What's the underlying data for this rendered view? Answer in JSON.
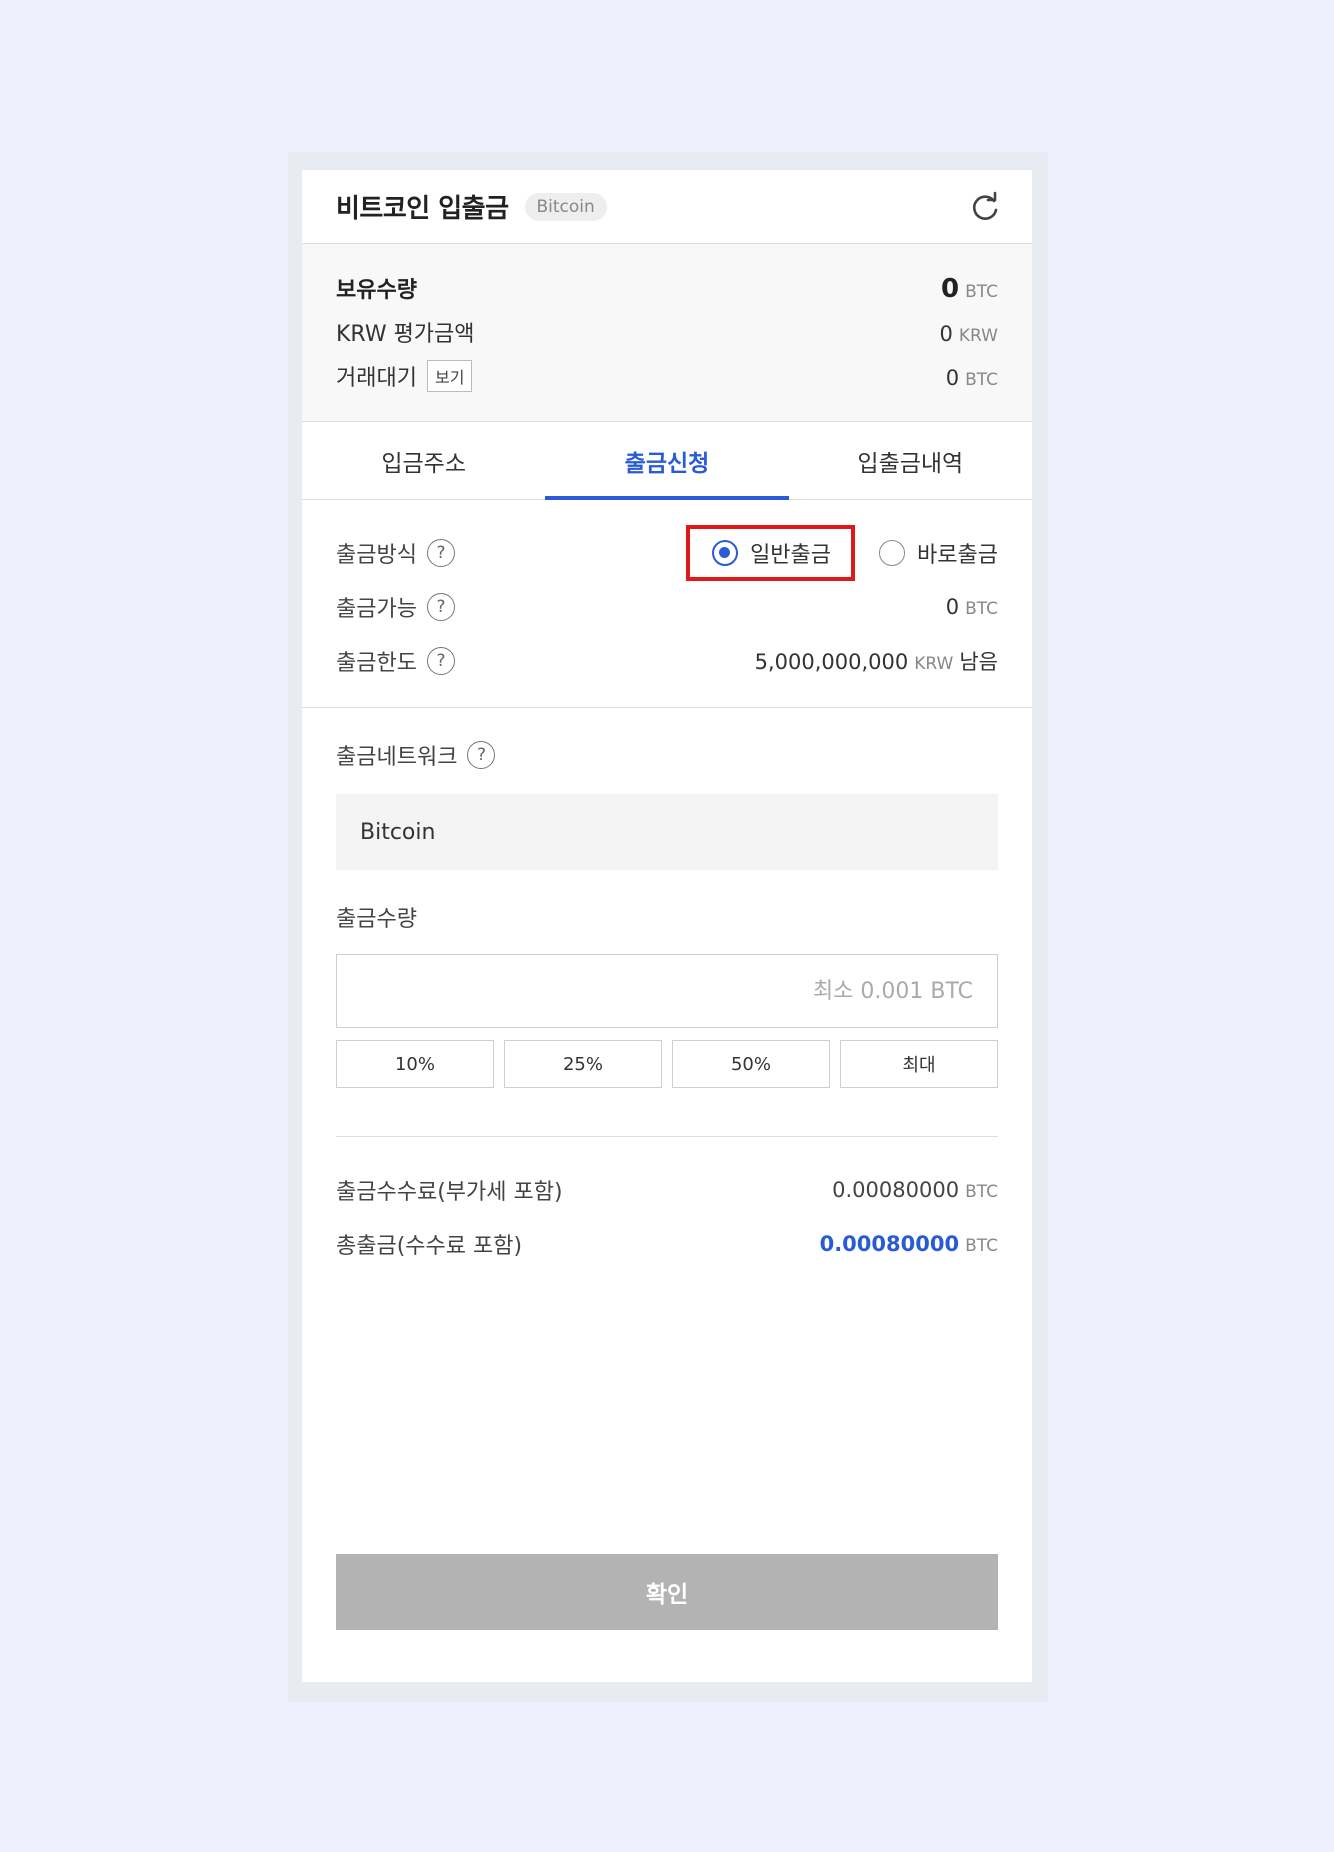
{
  "header": {
    "title": "비트코인 입출금",
    "badge": "Bitcoin"
  },
  "summary": {
    "holdings_label": "보유수량",
    "holdings_value": "0",
    "holdings_unit": "BTC",
    "krw_label": "KRW 평가금액",
    "krw_value": "0",
    "krw_unit": "KRW",
    "pending_label": "거래대기",
    "pending_view_button": "보기",
    "pending_value": "0",
    "pending_unit": "BTC"
  },
  "tabs": [
    {
      "label": "입금주소"
    },
    {
      "label": "출금신청",
      "active": true
    },
    {
      "label": "입출금내역"
    }
  ],
  "withdraw_info": {
    "method_label": "출금방식",
    "method_options": [
      {
        "label": "일반출금",
        "selected": true
      },
      {
        "label": "바로출금",
        "selected": false
      }
    ],
    "available_label": "출금가능",
    "available_value": "0",
    "available_unit": "BTC",
    "limit_label": "출금한도",
    "limit_value": "5,000,000,000",
    "limit_unit": "KRW",
    "limit_suffix": "남음"
  },
  "form": {
    "network_label": "출금네트워크",
    "network_value": "Bitcoin",
    "amount_label": "출금수량",
    "amount_placeholder": "최소 0.001 BTC",
    "percent_buttons": [
      "10%",
      "25%",
      "50%",
      "최대"
    ]
  },
  "fees": {
    "fee_label": "출금수수료(부가세 포함)",
    "fee_value": "0.00080000",
    "fee_unit": "BTC",
    "total_label": "총출금(수수료 포함)",
    "total_value": "0.00080000",
    "total_unit": "BTC"
  },
  "confirm_label": "확인",
  "help_glyph": "?",
  "colors": {
    "accent": "#2a5bd7",
    "highlight_box": "#e01818",
    "confirm_disabled": "#b3b3b3"
  }
}
